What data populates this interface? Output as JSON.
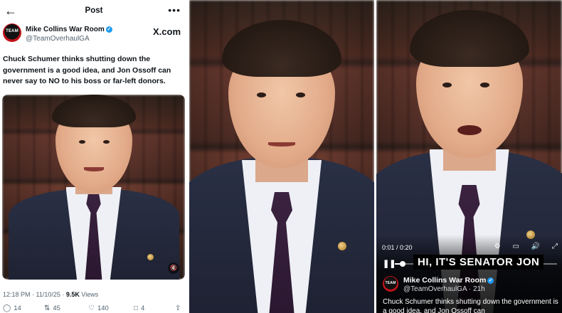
{
  "tweet": {
    "back_icon": "arrow-left",
    "title": "Post",
    "more_icon": "more-dots",
    "author_name": "Mike Collins War Room",
    "author_handle": "@TeamOverhaulGA",
    "avatar_text": "TEAM",
    "source": "X.com",
    "text": "Chuck Schumer thinks shutting down the government is a good idea, and Jon Ossoff can never say to NO to his boss or far-left donors.",
    "timestamp": "12:18 PM · 11/10/25 · ",
    "views_count": "9.5K",
    "views_label": " Views",
    "stats": {
      "replies": "14",
      "reposts": "45",
      "likes": "140",
      "bookmarks": "4"
    },
    "media_mute_icon": "volume-icon"
  },
  "video": {
    "time": "0:01 / 0:20",
    "progress": 0.05,
    "caption": "HI, IT'S SENATOR JON",
    "author_name": "Mike Collins War Room",
    "author_handle": "@TeamOverhaulGA",
    "age": "21h",
    "text_visible": "Chuck Schumer thinks shutting down the government is a good idea, and Jon Ossoff can",
    "controls": [
      "settings-icon",
      "airplay-icon",
      "volume-icon",
      "fullscreen-icon"
    ]
  },
  "colors": {
    "accent": "#1d9bf0",
    "text": "#0f1419",
    "muted": "#536471"
  }
}
